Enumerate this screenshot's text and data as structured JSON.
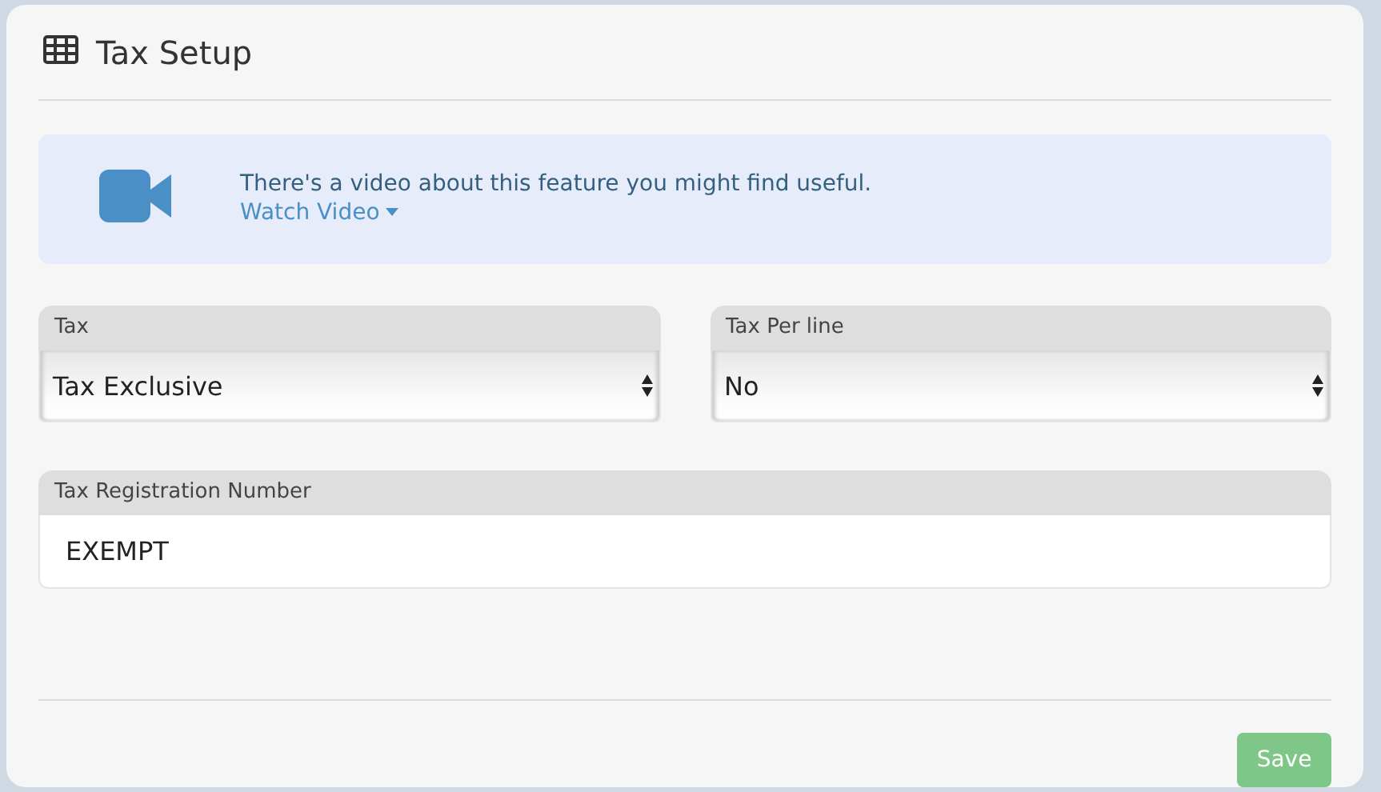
{
  "panel": {
    "title": "Tax Setup"
  },
  "video_notice": {
    "message": "There's a video about this feature you might find useful.",
    "link": "Watch Video"
  },
  "selects": [
    {
      "label": "Tax",
      "value": "Tax Exclusive"
    },
    {
      "label": "Tax Per line",
      "value": "No"
    }
  ],
  "registration": {
    "label": "Tax Registration Number",
    "value": "EXEMPT"
  },
  "save_button": {
    "label": "Save",
    "disabled": true
  }
}
